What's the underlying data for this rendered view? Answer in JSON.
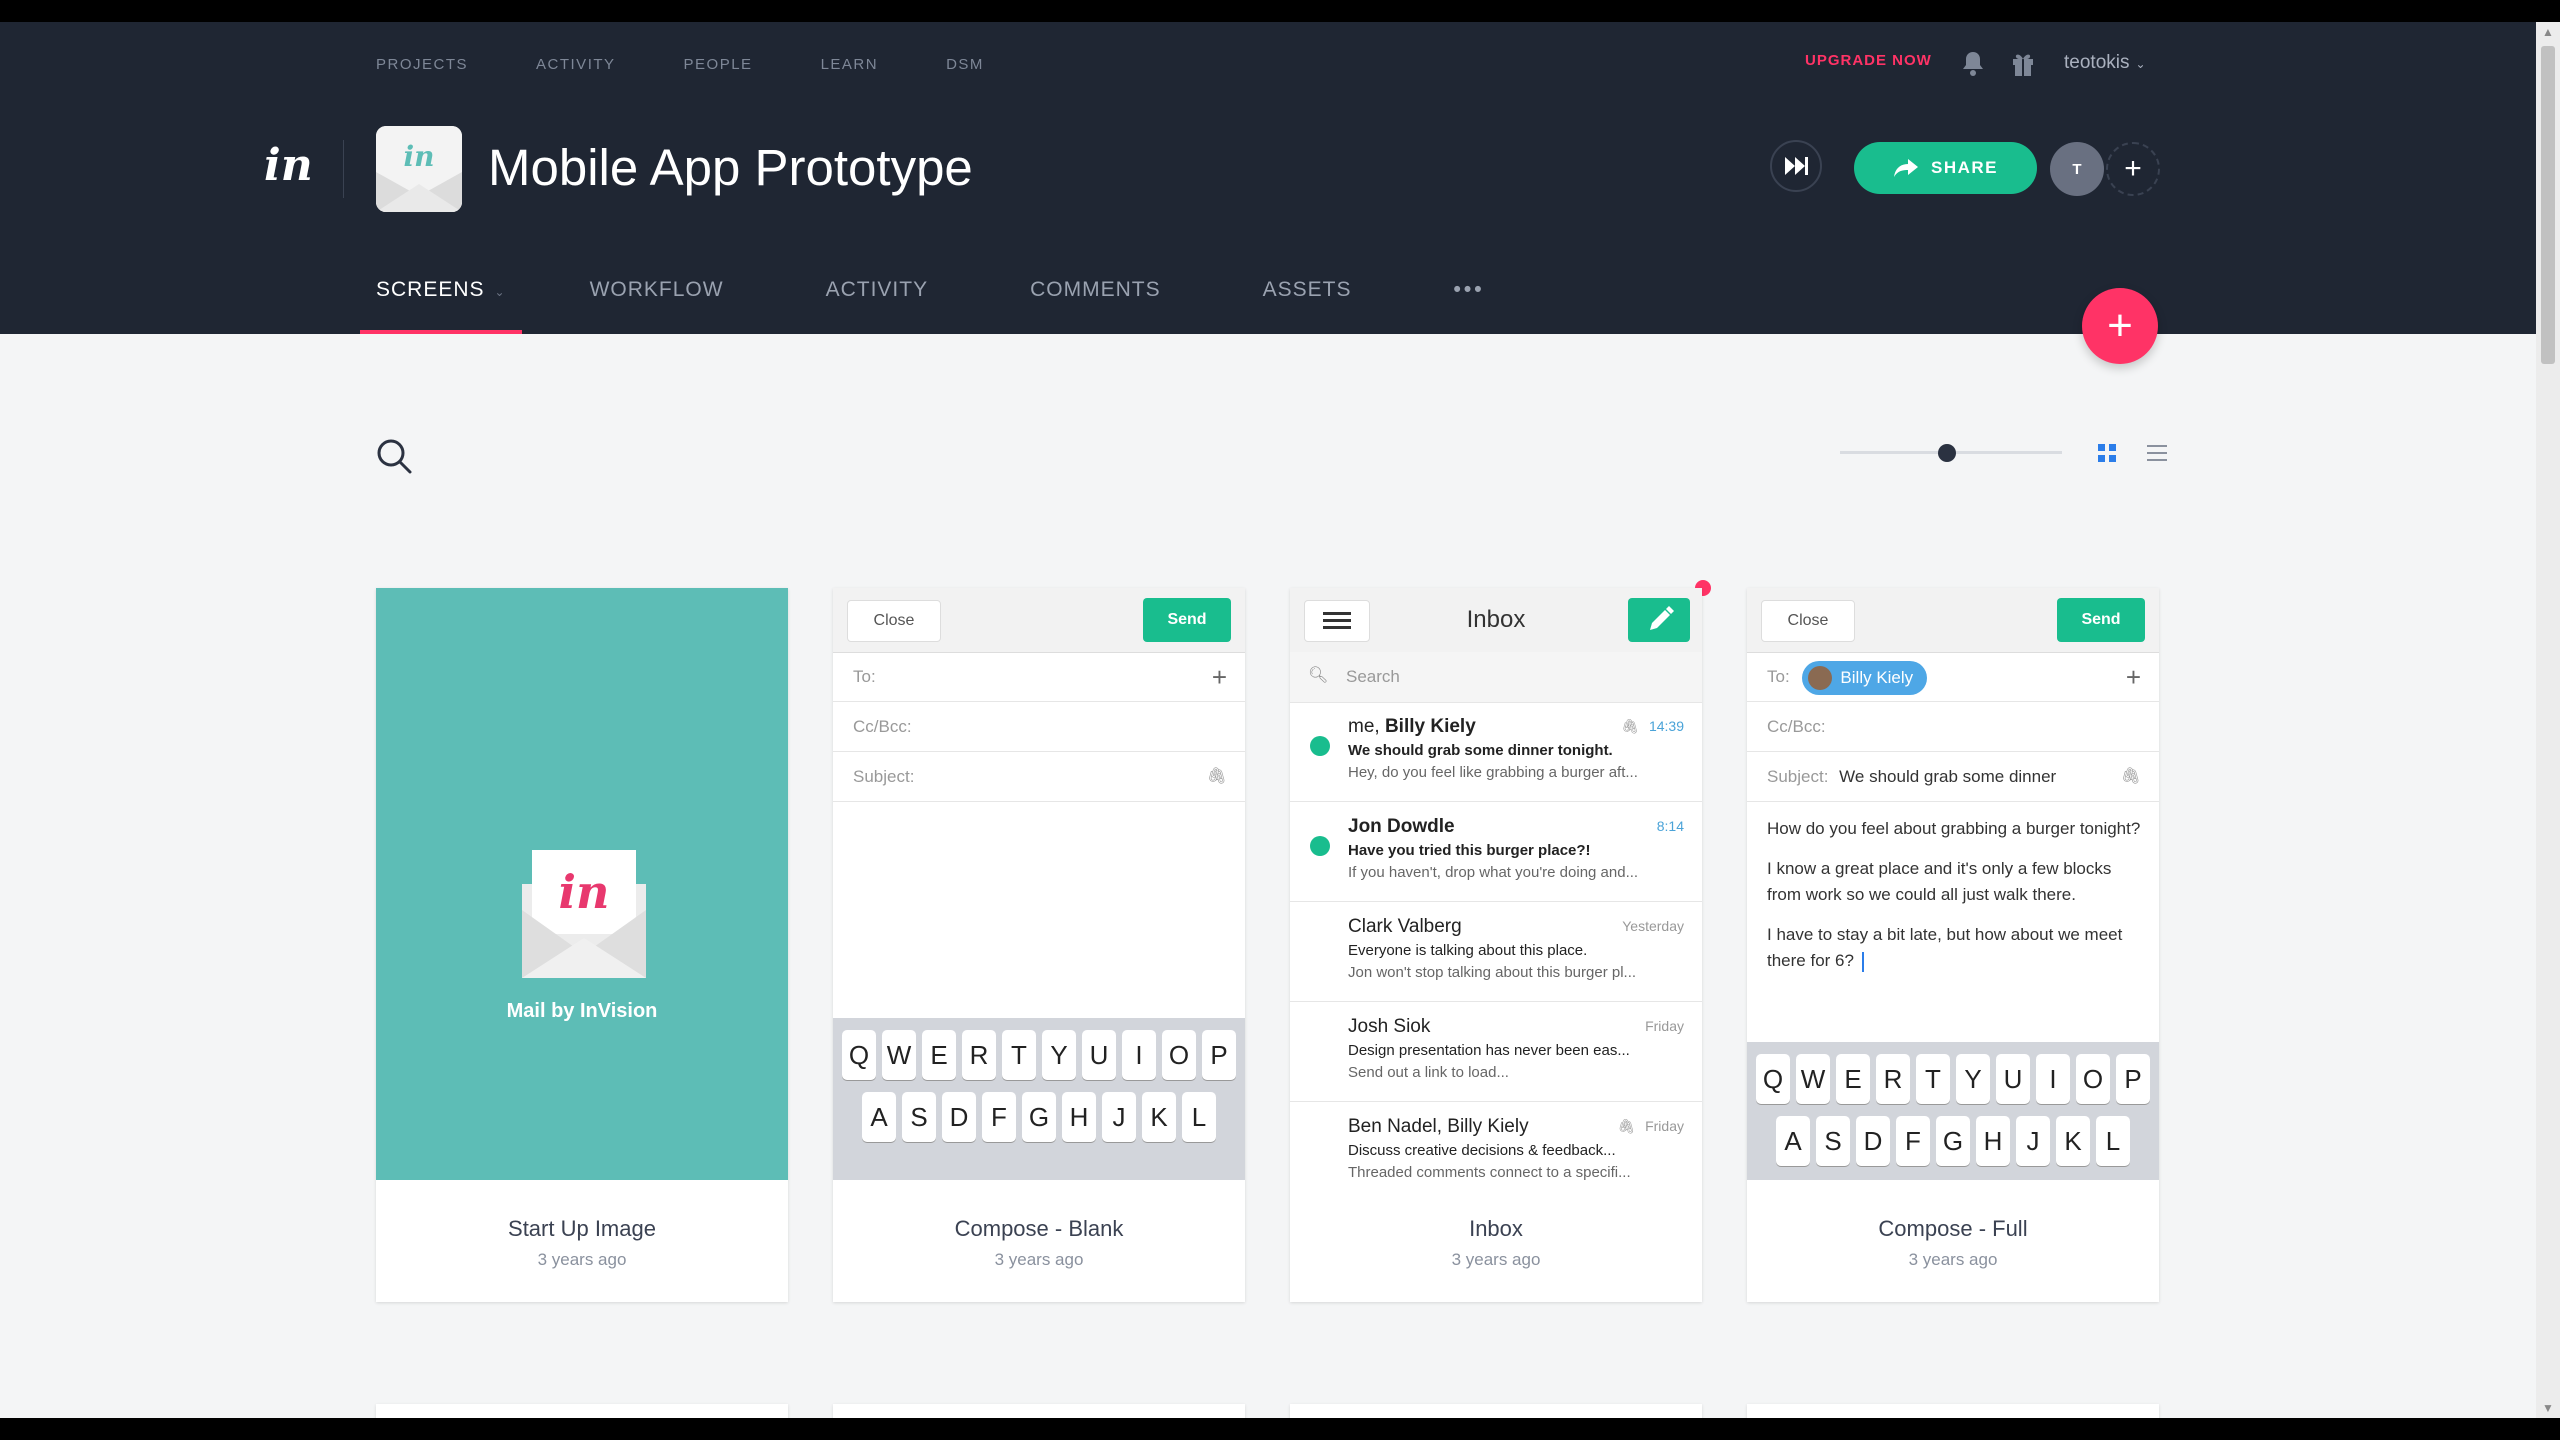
{
  "topnav": [
    "PROJECTS",
    "ACTIVITY",
    "PEOPLE",
    "LEARN",
    "DSM"
  ],
  "header": {
    "upgrade": "UPGRADE NOW",
    "user": "teotokis",
    "logo": "in",
    "title": "Mobile App Prototype",
    "share": "SHARE",
    "avatar_initial": "T"
  },
  "tabs": [
    "SCREENS",
    "WORKFLOW",
    "ACTIVITY",
    "COMMENTS",
    "ASSETS"
  ],
  "colors": {
    "accent": "#ff3366",
    "green": "#19bd8e",
    "header": "#1f2633",
    "blue": "#2b7de9"
  },
  "cards": [
    {
      "name": "Start Up Image",
      "time": "3 years ago"
    },
    {
      "name": "Compose - Blank",
      "time": "3 years ago"
    },
    {
      "name": "Inbox",
      "time": "3 years ago"
    },
    {
      "name": "Compose - Full",
      "time": "3 years ago"
    }
  ],
  "startup": {
    "label": "Mail by InVision"
  },
  "compose_blank": {
    "close": "Close",
    "send": "Send",
    "to": "To:",
    "ccbcc": "Cc/Bcc:",
    "subject": "Subject:",
    "keys_row1": [
      "Q",
      "W",
      "E",
      "R",
      "T",
      "Y",
      "U",
      "I",
      "O",
      "P"
    ],
    "keys_row2": [
      "A",
      "S",
      "D",
      "F",
      "G",
      "H",
      "J",
      "K",
      "L"
    ]
  },
  "inbox": {
    "title": "Inbox",
    "search": "Search",
    "emails": [
      {
        "from_prefix": "me, ",
        "from": "Billy Kiely",
        "subject": "We should grab some dinner tonight.",
        "preview": "Hey, do you feel like grabbing a burger aft...",
        "time": "14:39",
        "unread": true
      },
      {
        "from_prefix": "",
        "from": "Jon Dowdle",
        "subject": "Have you tried this burger place?!",
        "preview": "If you haven't, drop what you're doing and...",
        "time": "8:14",
        "unread": true
      },
      {
        "from_prefix": "",
        "from": "Clark Valberg",
        "subject": "Everyone is talking about this place.",
        "preview": "Jon won't stop talking about this burger pl...",
        "time": "Yesterday",
        "unread": false
      },
      {
        "from_prefix": "",
        "from": "Josh Siok",
        "subject": "Design presentation has never been eas...",
        "preview": "Send out a link to load...",
        "time": "Friday",
        "unread": false
      },
      {
        "from_prefix": "",
        "from": "Ben Nadel, Billy Kiely",
        "subject": "Discuss creative decisions & feedback...",
        "preview": "Threaded comments connect to a specifi...",
        "time": "Friday",
        "unread": false
      }
    ]
  },
  "compose_full": {
    "close": "Close",
    "send": "Send",
    "to": "To:",
    "recipient": "Billy Kiely",
    "ccbcc": "Cc/Bcc:",
    "subject_label": "Subject:",
    "subject_value": "We should grab some dinner",
    "body": [
      "How do you feel about grabbing a burger tonight?",
      "I know a great place and it's only a few blocks from work so we could all just walk there.",
      "I have to stay a bit late, but how about we meet there for 6?"
    ],
    "keys_row1": [
      "Q",
      "W",
      "E",
      "R",
      "T",
      "Y",
      "U",
      "I",
      "O",
      "P"
    ],
    "keys_row2": [
      "A",
      "S",
      "D",
      "F",
      "G",
      "H",
      "J",
      "K",
      "L"
    ]
  }
}
